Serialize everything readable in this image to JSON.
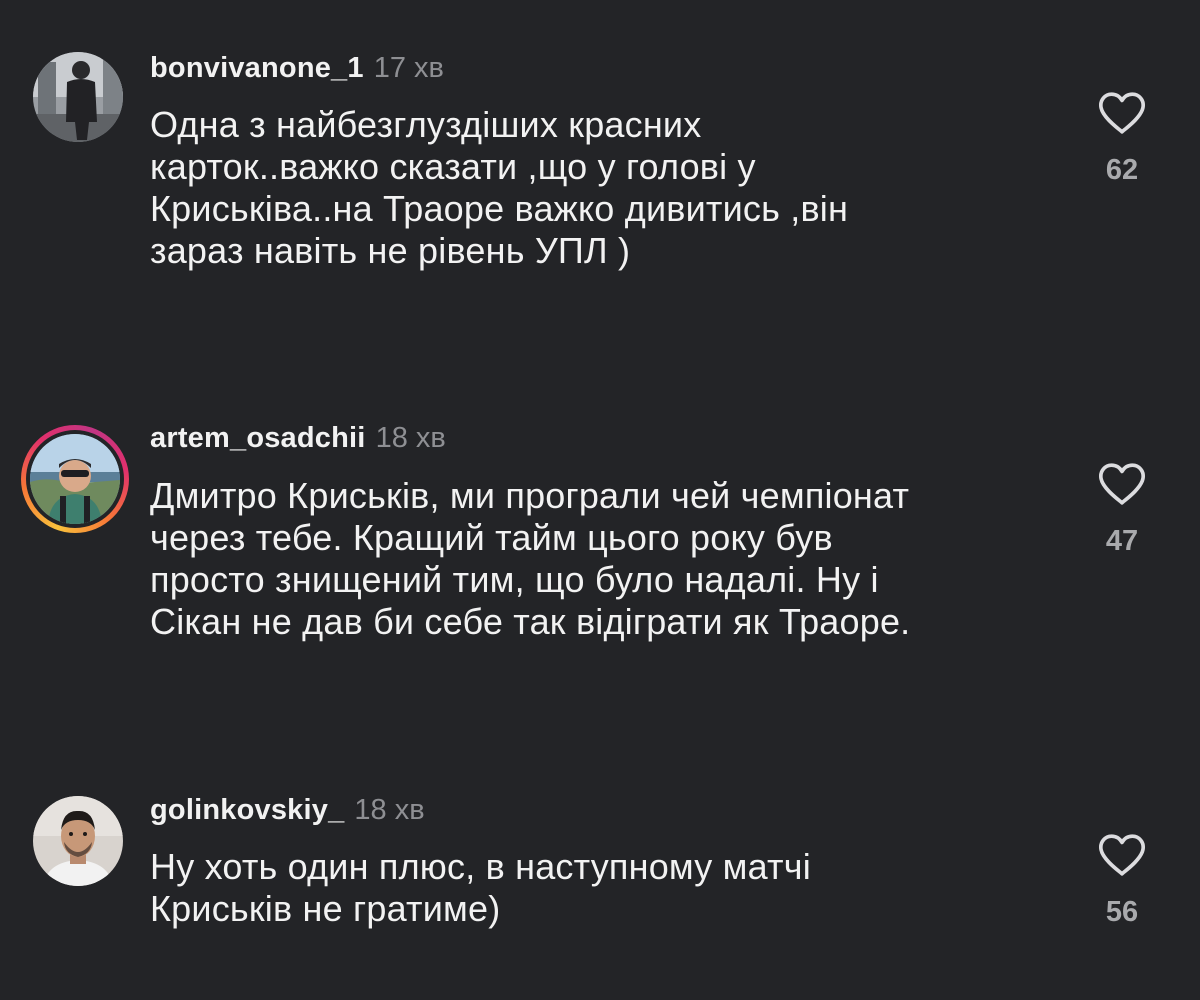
{
  "comments": [
    {
      "username": "bonvivanone_1",
      "time": "17 хв",
      "lines": [
        "Одна з найбезглуздіших красних",
        "карток..важко сказати ,що у голові у",
        "Криськіва..на Траоре важко дивитись ,він",
        "зараз навіть не рівень УПЛ )"
      ],
      "likes": "62",
      "like_icon": "heart-outline-icon"
    },
    {
      "username": "artem_osadchii",
      "time": "18 хв",
      "lines": [
        "Дмитро Криськів, ми програли чей чемпіонат",
        "через тебе. Кращий тайм цього року був",
        "просто знищений тим, що було надалі. Ну і",
        "Сікан не дав би себе так відіграти як Траоре."
      ],
      "likes": "47",
      "like_icon": "heart-outline-icon",
      "has_story": true
    },
    {
      "username": "golinkovskiy_",
      "time": "18 хв",
      "lines": [
        "Ну хоть один плюс, в наступному матчі",
        "Криськів не гратиме)"
      ],
      "likes": "56",
      "like_icon": "heart-outline-icon"
    }
  ],
  "colors": {
    "background": "#232427",
    "text": "#f2f2f2",
    "muted": "#8e8f93",
    "like_count": "#a9aaad"
  }
}
